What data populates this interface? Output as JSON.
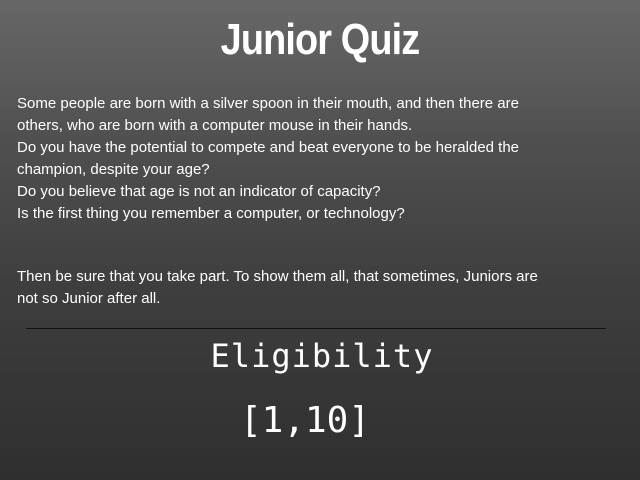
{
  "quiz": {
    "title": "Junior Quiz",
    "intro_lines": [
      "Some people are born with a silver spoon in their mouth, and then there are",
      "others, who are born with a computer mouse in their hands.",
      "Do you have the potential to compete and beat everyone to be heralded the",
      "champion, despite your age?",
      "Do you believe that age is not an indicator of capacity?",
      "Is the first thing you remember a computer, or technology?"
    ],
    "outro_lines": [
      "Then be sure that you take part. To show them all, that sometimes, Juniors are",
      "not so Junior after all."
    ],
    "eligibility_label": "Eligibility",
    "eligibility_range": "[1,10]"
  }
}
